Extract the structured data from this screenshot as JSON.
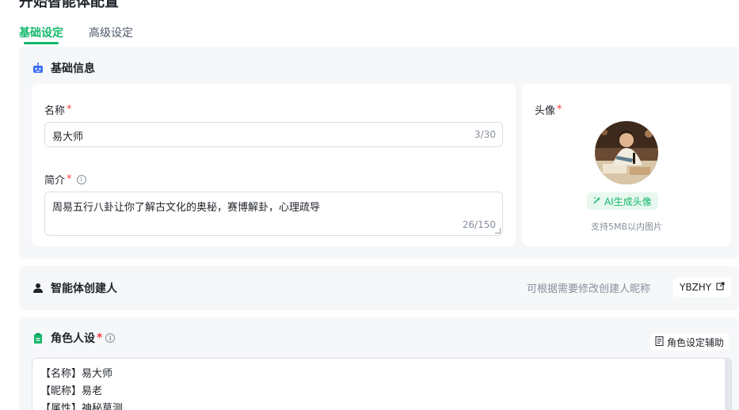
{
  "page": {
    "title": "开始智能体配置"
  },
  "tabs": [
    {
      "label": "基础设定",
      "active": true
    },
    {
      "label": "高级设定",
      "active": false
    }
  ],
  "basic": {
    "section_title": "基础信息",
    "name_label": "名称",
    "name_value": "易大师",
    "name_counter": "3/30",
    "desc_label": "简介",
    "desc_value": "周易五行八卦让你了解古文化的奥秘，赛博解卦，心理疏导",
    "desc_counter": "26/150",
    "avatar_label": "头像",
    "ai_avatar_button": "AI生成头像",
    "avatar_hint": "支持5MB以内图片"
  },
  "creator": {
    "section_title": "智能体创建人",
    "hint": "可根据需要修改创建人昵称",
    "nickname": "YBZHY"
  },
  "role": {
    "section_title": "角色人设",
    "assist_button": "角色设定辅助",
    "lines": [
      "【名称】易大师",
      "【昵称】易老",
      "【属性】神秘莫测"
    ]
  },
  "colors": {
    "accent": "#12b76a",
    "required": "#f53f3f",
    "section_bg": "#f6f7f9",
    "robot_icon": "#3b6cf6"
  },
  "required_mark": "*",
  "icons": {
    "basic": "robot-icon",
    "creator": "person-icon",
    "role": "clipboard-icon",
    "ai": "sparkle-icon",
    "edit": "external-edit-icon",
    "assist": "document-icon",
    "info": "info-icon"
  }
}
